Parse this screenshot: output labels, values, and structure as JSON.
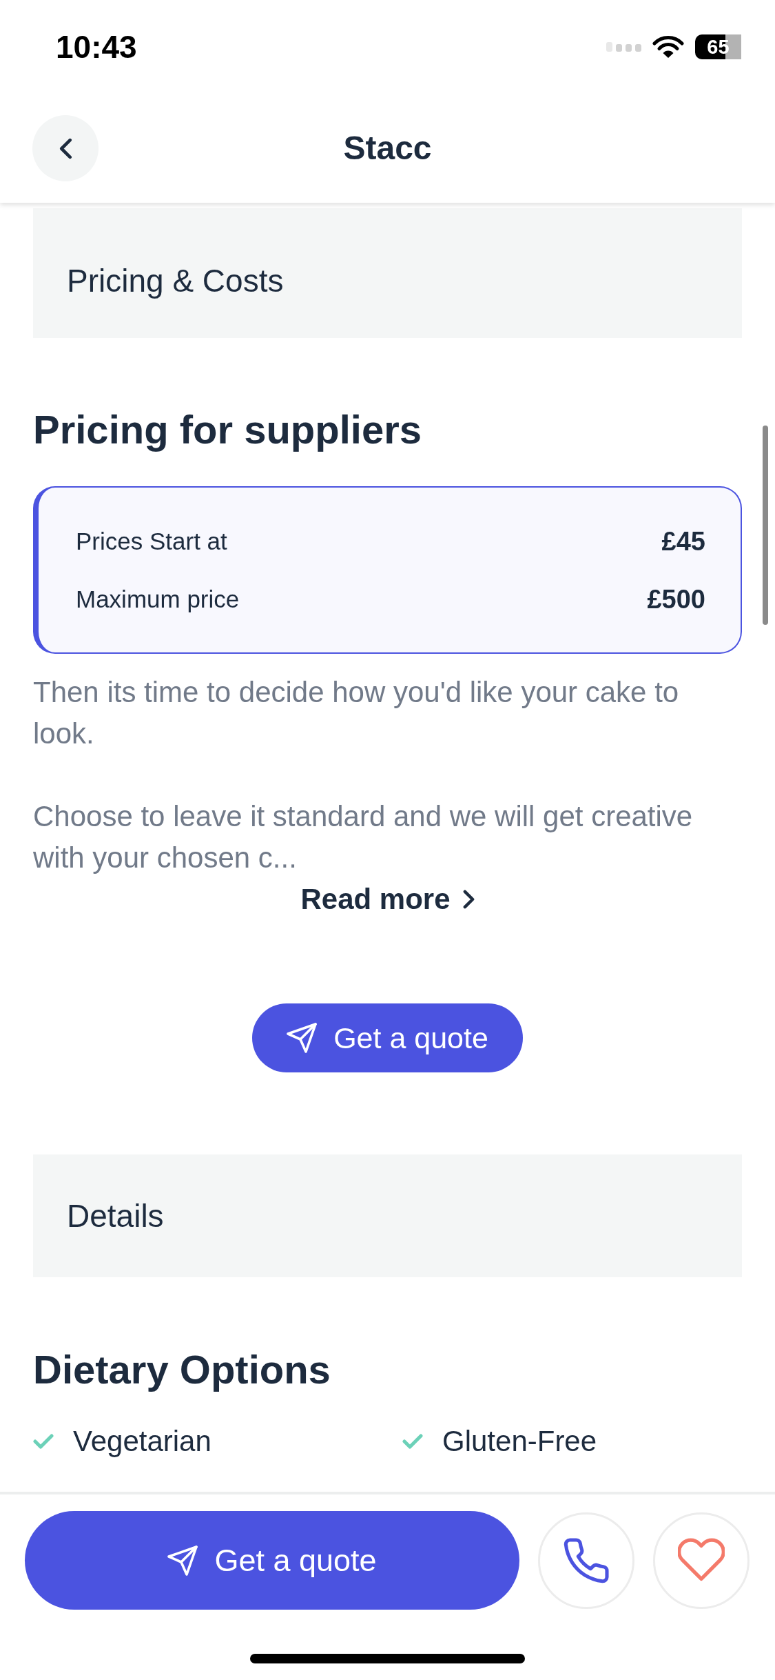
{
  "status_bar": {
    "time": "10:43",
    "battery": "65"
  },
  "nav_bar": {
    "title": "Stacc"
  },
  "pricing_section": {
    "title": "Pricing & Costs",
    "heading": "Pricing for suppliers",
    "prices": [
      {
        "label": "Prices Start at",
        "value": "£45"
      },
      {
        "label": "Maximum price",
        "value": "£500"
      }
    ],
    "description": [
      "Then its time to decide how you'd like your cake to look.",
      "Choose to leave it standard and we will get creative with your chosen c..."
    ],
    "read_more": "Read more",
    "quote_button": "Get a quote"
  },
  "details_section": {
    "title": "Details",
    "heading": "Dietary Options",
    "options": [
      {
        "label": "Vegetarian",
        "checked": true
      },
      {
        "label": "Gluten-Free",
        "checked": true
      }
    ]
  },
  "bottom_bar": {
    "quote_button": "Get a quote"
  }
}
